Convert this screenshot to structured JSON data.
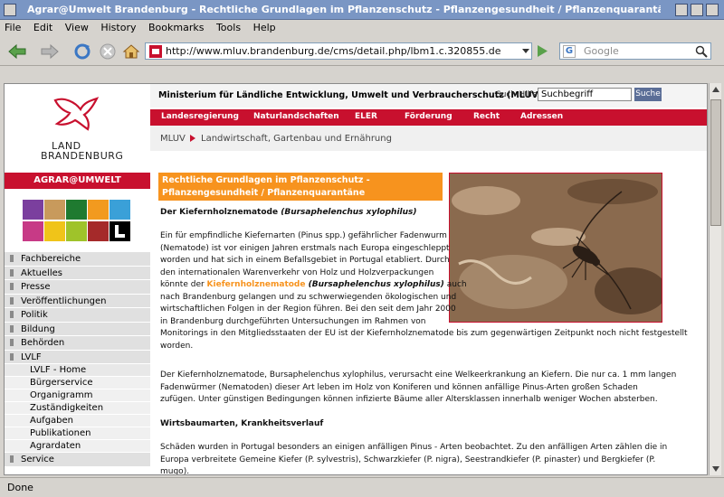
{
  "window": {
    "title": "Agrar@Umwelt Brandenburg - Rechtliche Grundlagen im Pflanzenschutz - Pflanzengesundheit / Pflanzenquarantäne - Mozilla Firefox"
  },
  "menu": [
    "File",
    "Edit",
    "View",
    "History",
    "Bookmarks",
    "Tools",
    "Help"
  ],
  "browser": {
    "url": "http://www.mluv.brandenburg.de/cms/detail.php/lbm1.c.320855.de",
    "search_placeholder": "Google",
    "status": "Done"
  },
  "site": {
    "logo_line1": "LAND",
    "logo_line2": "BRANDENBURG",
    "section_bar": "AGRAR@UMWELT",
    "ministry": "Ministerium für Ländliche Entwicklung, Umwelt und Verbraucherschutz (MLUV)",
    "search_label": "Such-Hilfe",
    "search_value": "Suchbegriff",
    "search_button": "Suche",
    "topmenu": [
      "Landesregierung",
      "Naturlandschaften",
      "ELER",
      "Förderung",
      "Recht",
      "Adressen"
    ],
    "breadcrumb": [
      "MLUV",
      "Landwirtschaft, Gartenbau und Ernährung"
    ],
    "tile_colors": [
      "#7b3f9e",
      "#c89a5c",
      "#1f7a30",
      "#f29a1f",
      "#3aa0d8",
      "#c73a86",
      "#f0c419",
      "#9fc32a",
      "#a52a2a",
      "#000000"
    ]
  },
  "sidebar": {
    "items": [
      "Fachbereiche",
      "Aktuelles",
      "Presse",
      "Veröffentlichungen",
      "Politik",
      "Bildung",
      "Behörden",
      "LVLF"
    ],
    "lvlf_sub": [
      "LVLF - Home",
      "Bürgerservice",
      "Organigramm",
      "Zuständigkeiten",
      "Aufgaben",
      "Publikationen",
      "Agrardaten"
    ],
    "after": [
      "Service"
    ]
  },
  "article": {
    "header": "Rechtliche Grundlagen im Pflanzenschutz - Pflanzengesundheit / Pflanzenquarantäne",
    "subtitle_plain": "Der Kiefernholznematode ",
    "subtitle_italic": "(Bursaphelenchus xylophilus)",
    "p1_lines": [
      "Ein für empfindliche Kiefernarten (Pinus spp.) gefährlicher Fadenwurm",
      "(Nematode) ist vor einigen Jahren erstmals nach Europa eingeschleppt",
      "worden und hat sich in einem Befallsgebiet in Portugal etabliert. Durch",
      "den internationalen Warenverkehr von Holz und Holzverpackungen"
    ],
    "p1_link_pre": "könnte der ",
    "p1_link": "Kiefernholznematode",
    "p1_link_bold": " (Bursaphelenchus xylophilus)",
    "p1_link_post": " auch",
    "p1_lines2": [
      "nach Brandenburg gelangen und zu schwerwiegenden ökologischen und",
      "wirtschaftlichen Folgen in der Region führen. Bei den seit dem Jahr 2000",
      "in Brandenburg durchgeführten Untersuchungen im Rahmen von",
      "Monitorings in den Mitgliedsstaaten der EU ist der Kiefernholznematode bis zum gegenwärtigen Zeitpunkt noch nicht festgestellt",
      "worden."
    ],
    "p2_lines": [
      "Der Kiefernholznematode, Bursaphelenchus xylophilus, verursacht eine Welkeerkrankung an Kiefern. Die nur ca. 1 mm langen",
      "Fadenwürmer (Nematoden) dieser Art leben im Holz von Koniferen und können anfällige Pinus-Arten großen Schaden",
      "zufügen. Unter günstigen Bedingungen können infizierte Bäume aller Altersklassen innerhalb weniger Wochen absterben."
    ],
    "h2": "Wirtsbaumarten, Krankheitsverlauf",
    "p3_lines": [
      "Schäden wurden in Portugal besonders an einigen anfälligen Pinus - Arten beobachtet. Zu den anfälligen Arten zählen die in",
      "Europa verbreitete Gemeine Kiefer (P. sylvestris), Schwarzkiefer (P. nigra), Seestrandkiefer (P. pinaster) und Bergkiefer (P.",
      "mugo)."
    ]
  }
}
